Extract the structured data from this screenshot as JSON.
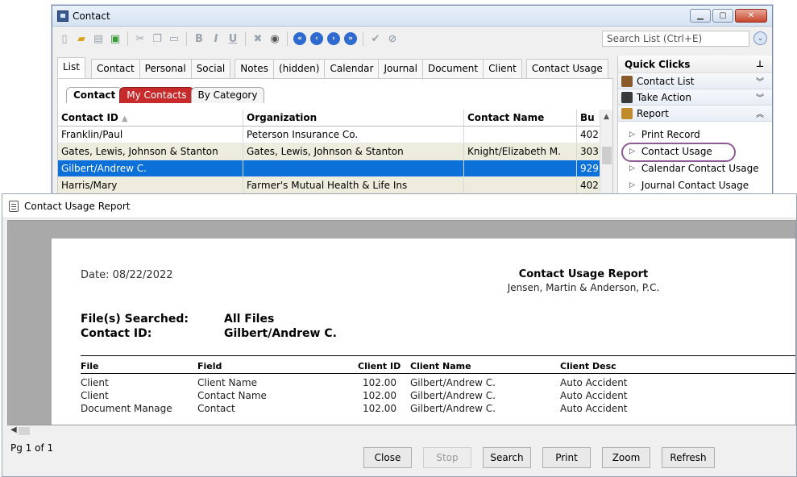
{
  "contact_window": {
    "title": "Contact",
    "search_placeholder": "Search List (Ctrl+E)",
    "tabs": [
      "List",
      "Contact",
      "Personal",
      "Social",
      "Notes",
      "(hidden)",
      "Calendar",
      "Journal",
      "Document",
      "Client",
      "Contact Usage"
    ],
    "subtabs": [
      "Contact",
      "My Contacts",
      "By Category"
    ],
    "columns": [
      "Contact ID",
      "Organization",
      "Contact Name",
      "Bu"
    ],
    "rows": [
      {
        "contact_id": "Franklin/Paul",
        "organization": "Peterson Insurance Co.",
        "contact_name": "",
        "bus": "402"
      },
      {
        "contact_id": "Gates, Lewis, Johnson & Stanton",
        "organization": "Gates, Lewis, Johnson & Stanton",
        "contact_name": "Knight/Elizabeth M.",
        "bus": "303"
      },
      {
        "contact_id": "Gilbert/Andrew C.",
        "organization": "",
        "contact_name": "",
        "bus": "929"
      },
      {
        "contact_id": "Harris/Mary",
        "organization": "Farmer's Mutual Health & Life Ins",
        "contact_name": "",
        "bus": "402"
      }
    ],
    "quick_clicks": {
      "header": "Quick Clicks",
      "sections": [
        "Contact List",
        "Take Action",
        "Report"
      ],
      "report_items": [
        "Print Record",
        "Contact Usage",
        "Calendar Contact Usage",
        "Journal Contact Usage"
      ]
    }
  },
  "report_window": {
    "title": "Contact Usage Report",
    "date": "Date: 08/22/2022",
    "report_title": "Contact Usage Report",
    "firm": "Jensen, Martin & Anderson, P.C.",
    "files_label": "File(s) Searched:",
    "files_value": "All Files",
    "contact_label": "Contact ID:",
    "contact_value": "Gilbert/Andrew C.",
    "columns": [
      "File",
      "Field",
      "Client ID",
      "Client Name",
      "Client Desc"
    ],
    "rows": [
      {
        "file": "Client",
        "field": "Client Name",
        "client_id": "102.00",
        "client_name": "Gilbert/Andrew C.",
        "client_desc": "Auto Accident"
      },
      {
        "file": "Client",
        "field": "Contact Name",
        "client_id": "102.00",
        "client_name": "Gilbert/Andrew C.",
        "client_desc": "Auto Accident"
      },
      {
        "file": "Document Manage",
        "field": "Contact",
        "client_id": "102.00",
        "client_name": "Gilbert/Andrew C.",
        "client_desc": "Auto Accident"
      }
    ],
    "page_indicator": "Pg 1 of 1",
    "buttons": [
      "Close",
      "Stop",
      "Search",
      "Print",
      "Zoom",
      "Refresh"
    ]
  },
  "colors": {
    "selection": "#0b70d8",
    "alt_row": "#eeecdc",
    "my_contacts_tab": "#c62a2a",
    "highlight_oval": "#8e5a96"
  }
}
